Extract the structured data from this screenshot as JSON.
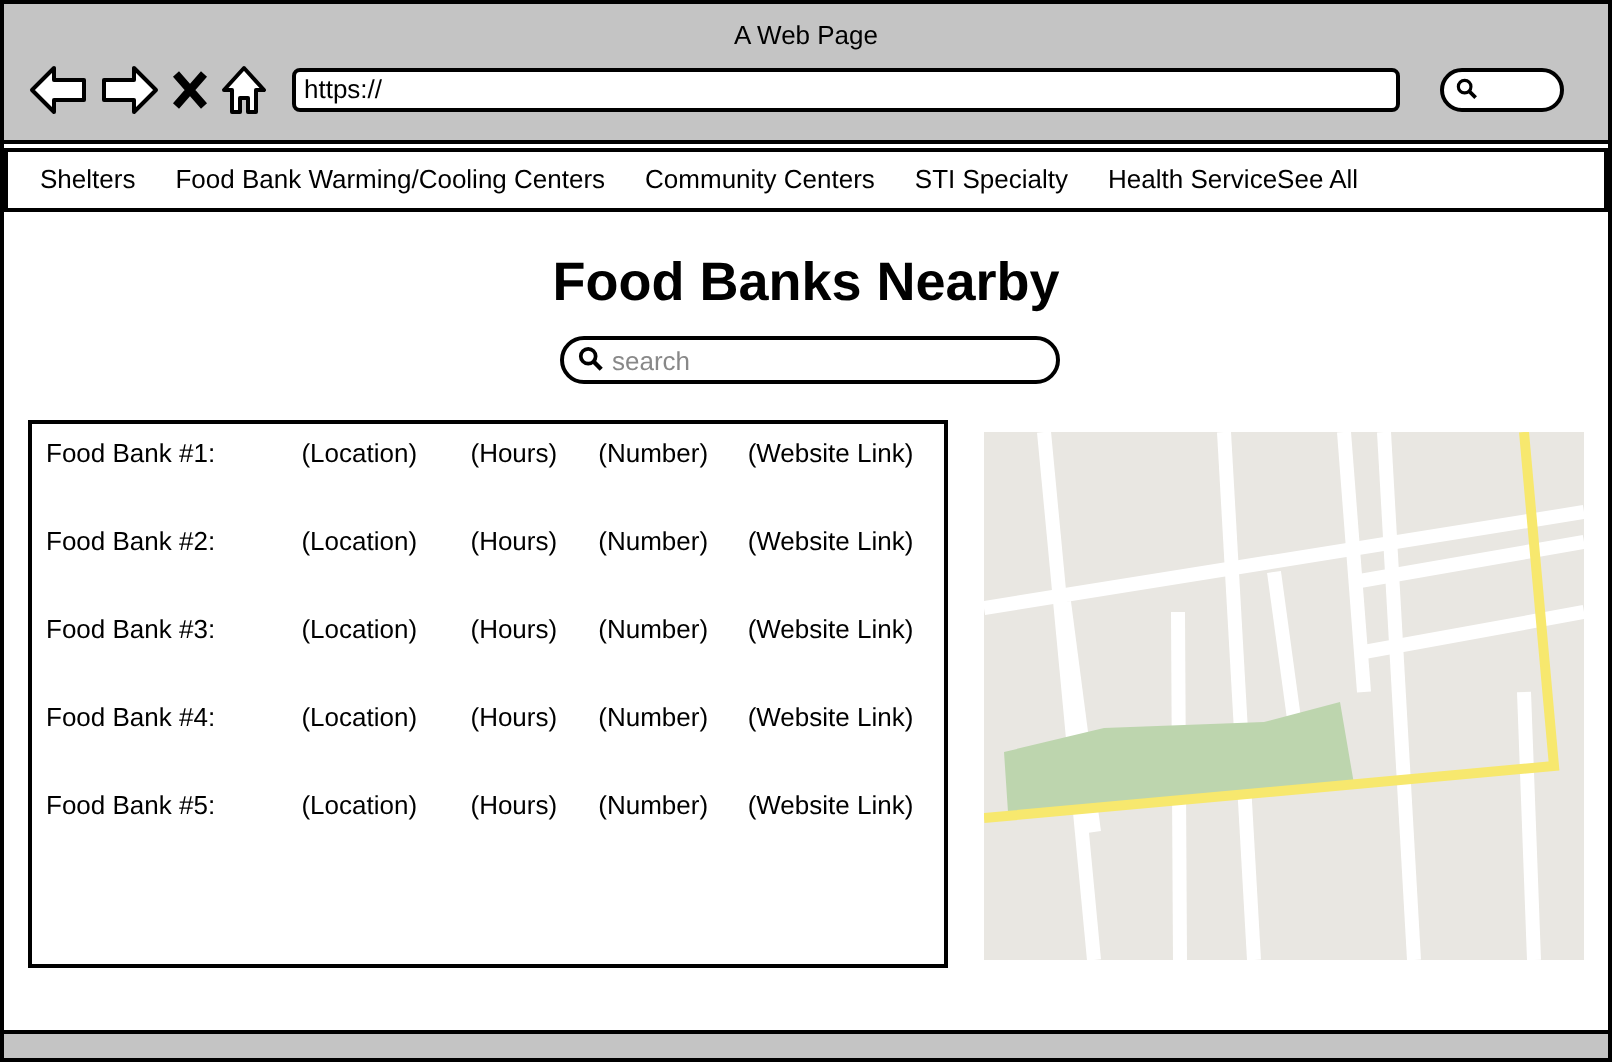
{
  "window": {
    "title": "A Web Page"
  },
  "address_bar": {
    "value": "https://"
  },
  "nav": {
    "items": [
      "Shelters",
      "Food Bank Warming/Cooling Centers",
      "Community Centers",
      "STI Specialty",
      "Health ServiceSee All"
    ]
  },
  "heading": "Food Banks Nearby",
  "search": {
    "placeholder": "search"
  },
  "food_banks": [
    {
      "name": "Food Bank #1:",
      "location": "(Location)",
      "hours": "(Hours)",
      "number": "(Number)",
      "website": "(Website Link)"
    },
    {
      "name": "Food Bank #2:",
      "location": "(Location)",
      "hours": "(Hours)",
      "number": "(Number)",
      "website": "(Website Link)"
    },
    {
      "name": "Food Bank #3:",
      "location": "(Location)",
      "hours": "(Hours)",
      "number": "(Number)",
      "website": "(Website Link)"
    },
    {
      "name": "Food Bank #4:",
      "location": "(Location)",
      "hours": "(Hours)",
      "number": "(Number)",
      "website": "(Website Link)"
    },
    {
      "name": "Food Bank #5:",
      "location": "(Location)",
      "hours": "(Hours)",
      "number": "(Number)",
      "website": "(Website Link)"
    }
  ]
}
